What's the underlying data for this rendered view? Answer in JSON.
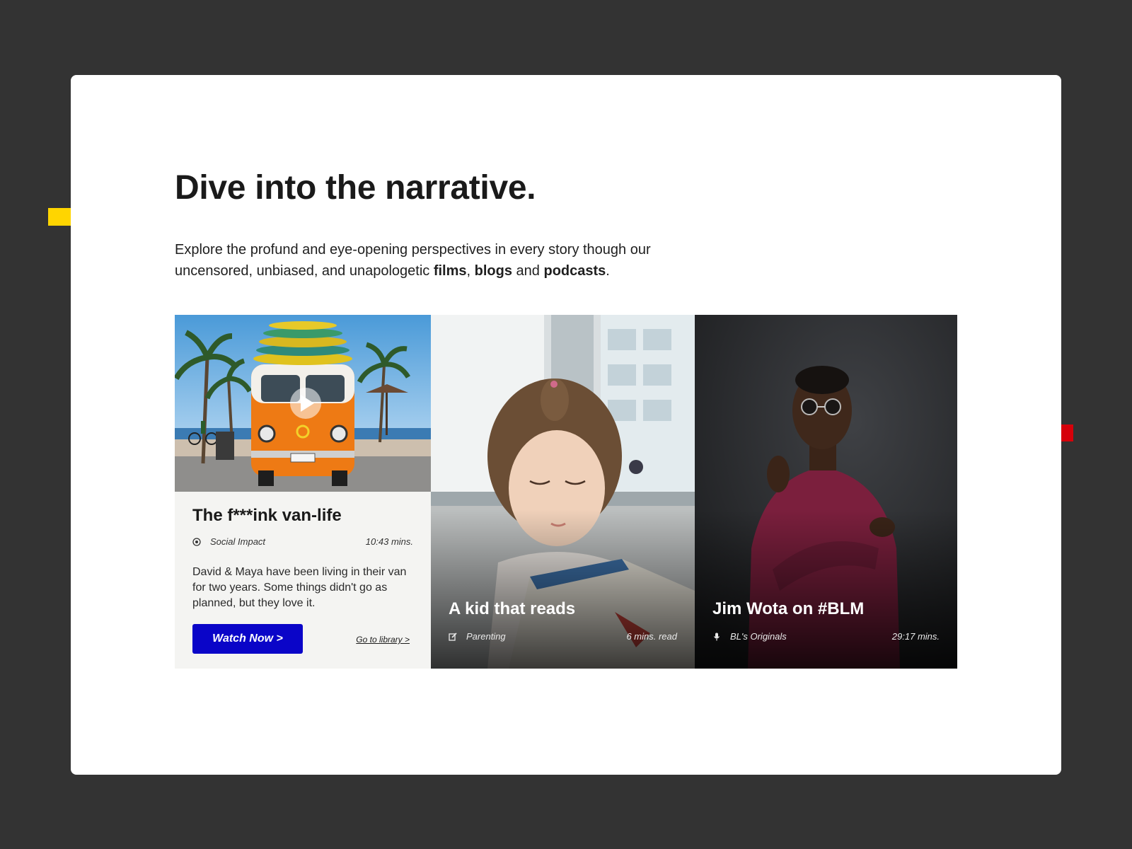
{
  "hero": {
    "title": "Dive into the narrative.",
    "intro_prefix": "Explore the profund and eye-opening perspectives in every story though our uncensored, unbiased, and unapologetic ",
    "intro_films": "films",
    "intro_sep": ", ",
    "intro_blogs": "blogs",
    "intro_and": " and ",
    "intro_podcasts": "podcasts",
    "intro_end": "."
  },
  "stories": [
    {
      "title": "The f***ink van-life",
      "category": "Social Impact",
      "category_icon": "target-icon",
      "duration": "10:43 mins.",
      "description": "David & Maya have been living in their van for two years. Some things didn't go as planned, but they love it.",
      "cta_label": "Watch Now >",
      "link_label": "Go to library >",
      "media": "video"
    },
    {
      "title": "A kid that reads",
      "category": "Parenting",
      "category_icon": "edit-icon",
      "duration": "6 mins. read",
      "media": "blog"
    },
    {
      "title": "Jim Wota on #BLM",
      "category": "BL's Originals",
      "category_icon": "microphone-icon",
      "duration": "29:17 mins.",
      "media": "podcast"
    }
  ],
  "colors": {
    "background": "#333333",
    "card": "#ffffff",
    "accent_blue": "#0a05c8",
    "deco_yellow": "#ffd500",
    "deco_red": "#d6000a"
  }
}
